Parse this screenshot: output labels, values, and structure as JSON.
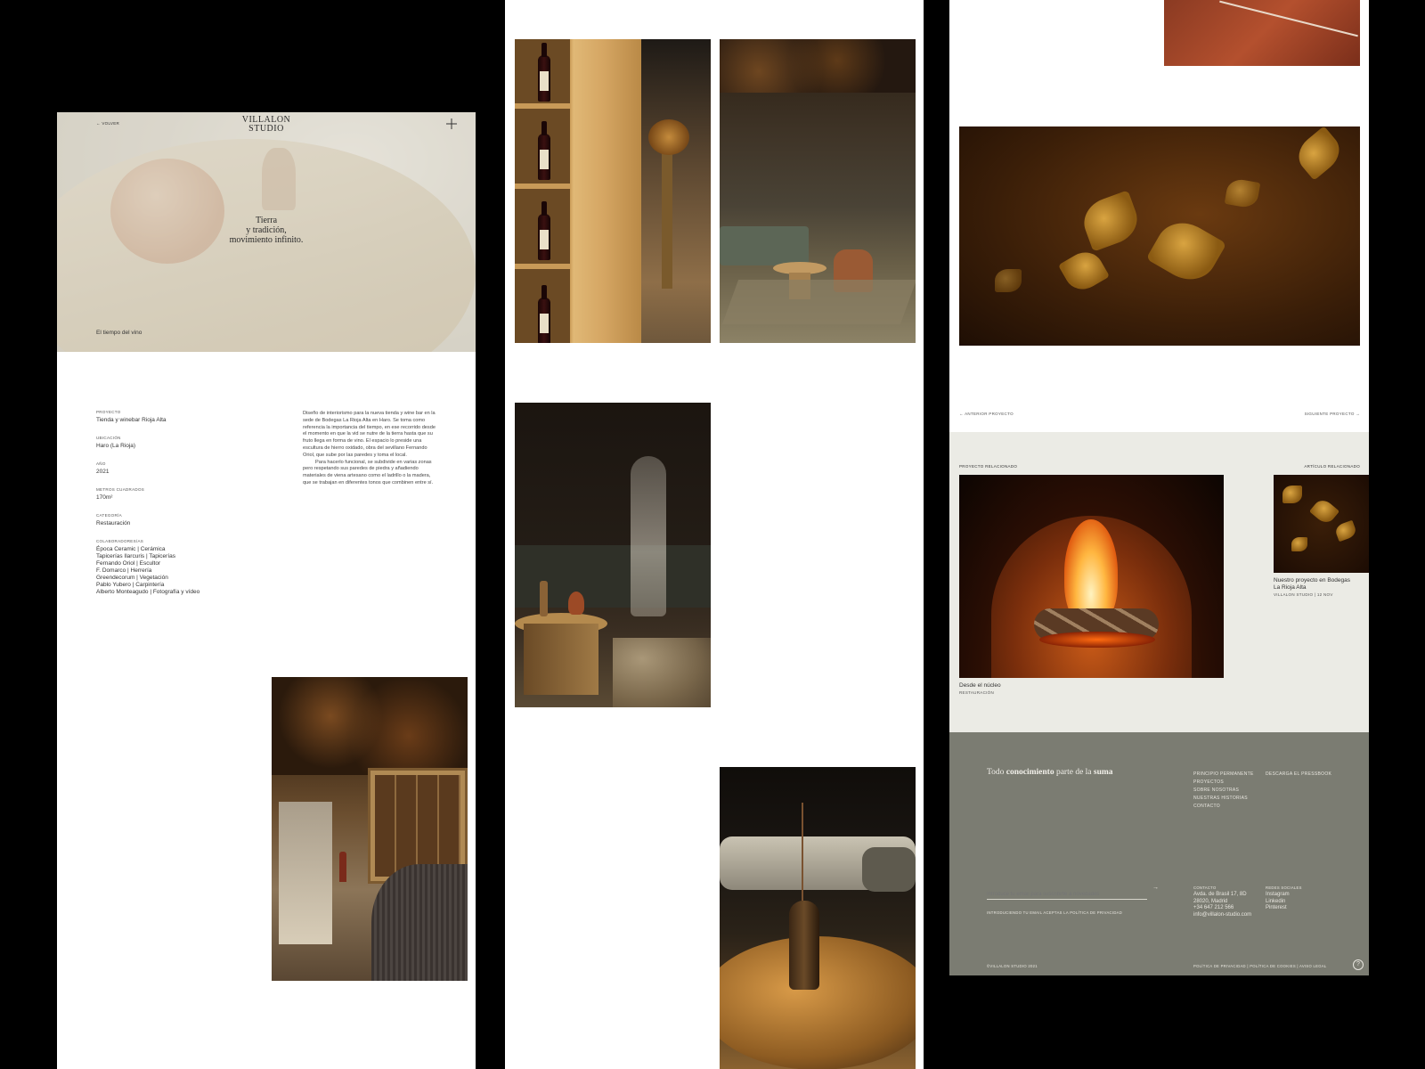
{
  "hero": {
    "back_label": "VOLVER",
    "logo_line1": "VILLALON",
    "logo_line2": "STUDIO",
    "plus_icon": "plus-icon",
    "tagline_line1": "Tierra",
    "tagline_line2": "y tradición,",
    "tagline_line3_bold": "movimiento",
    "tagline_line3_rest": " infinito.",
    "caption": "El tiempo del vino"
  },
  "details": [
    {
      "label": "PROYECTO",
      "value": "Tienda y winebar Rioja Alta"
    },
    {
      "label": "UBICACIÓN",
      "value": "Haro (La Rioja)"
    },
    {
      "label": "AÑO",
      "value": "2021"
    },
    {
      "label": "METROS CUADRADOS",
      "value": "170m²"
    },
    {
      "label": "CATEGORÍA",
      "value": "Restauración"
    }
  ],
  "collaborators": {
    "label": "COLABORADORES/AS",
    "items": [
      "Época Ceramic | Cerámica",
      "Tapicerías Ilarcuris | Tapicerías",
      "Fernando Oriol | Escultor",
      "F. Domarco | Herrería",
      "Greendecorum | Vegetación",
      "Pablo Yubero | Carpintería",
      "Alberto Monteagudo | Fotografía y vídeo"
    ]
  },
  "description": {
    "p1": "Diseño de interiorismo para la nueva tienda y wine bar en la sede de Bodegas La Rioja Alta en Haro. Se toma como referencia la importancia del tiempo, en ese recorrido desde el momento en que la vid se nutre de la tierra hasta que su fruto llega en forma de vino. El espacio lo preside una escultura de hierro oxidado, obra del sevillano Fernando Oriol, que sube por las paredes y toma el local.",
    "p2": "Para hacerlo funcional, se subdivide en varias zonas pero respetando sus paredes de piedra y añadiendo materiales de viena artesano como el ladrillo o la madera, que se trabajan en diferentes tonos que combinen entre sí."
  },
  "nav": {
    "prev": "← ANTERIOR PROYECTO",
    "next": "SIGUIENTE PROYECTO →"
  },
  "related": {
    "project_label": "PROYECTO RELACIONADO",
    "article_label": "ARTÍCULO RELACIONADO",
    "project_title": "Desde el núcleo",
    "project_category": "RESTAURACIÓN",
    "article_title_line1": "Nuestro proyecto en Bodegas",
    "article_title_line2": "La Rioja Alta",
    "article_meta": "VILLALON STUDIO | 12 NOV"
  },
  "footer": {
    "headline_pre": "Todo ",
    "headline_bold1": "conocimiento",
    "headline_mid": " parte de la ",
    "headline_bold2": "suma",
    "links_col1": [
      "PRINCIPIO PERMANENTE",
      "PROYECTOS",
      "SOBRE NOSOTRAS",
      "NUESTRAS HISTORIAS",
      "CONTACTO"
    ],
    "links_col2": [
      "DESCARGA EL PRESSBOOK"
    ],
    "newsletter_placeholder": "Introduce tu email para suscribirte a novedades",
    "privacy_note": "INTRODUCIENDO TU EMAIL ACEPTAS LA POLÍTICA DE PRIVACIDAD",
    "contact_label": "CONTACTO",
    "contact_lines": [
      "Avda. de Brasil 17, 8D",
      "28020, Madrid",
      "+34 647 212 566",
      "info@villalon-studio.com"
    ],
    "social_label": "REDES SOCIALES",
    "social_links": [
      "Instagram",
      "Linkedin",
      "Pinterest"
    ],
    "copyright": "©VILLALON STUDIO 2021",
    "legal": "POLÍTICA DE PRIVACIDAD | POLÍTICA DE COOKIES | AVISO LEGAL",
    "chat_icon": "question-icon"
  }
}
